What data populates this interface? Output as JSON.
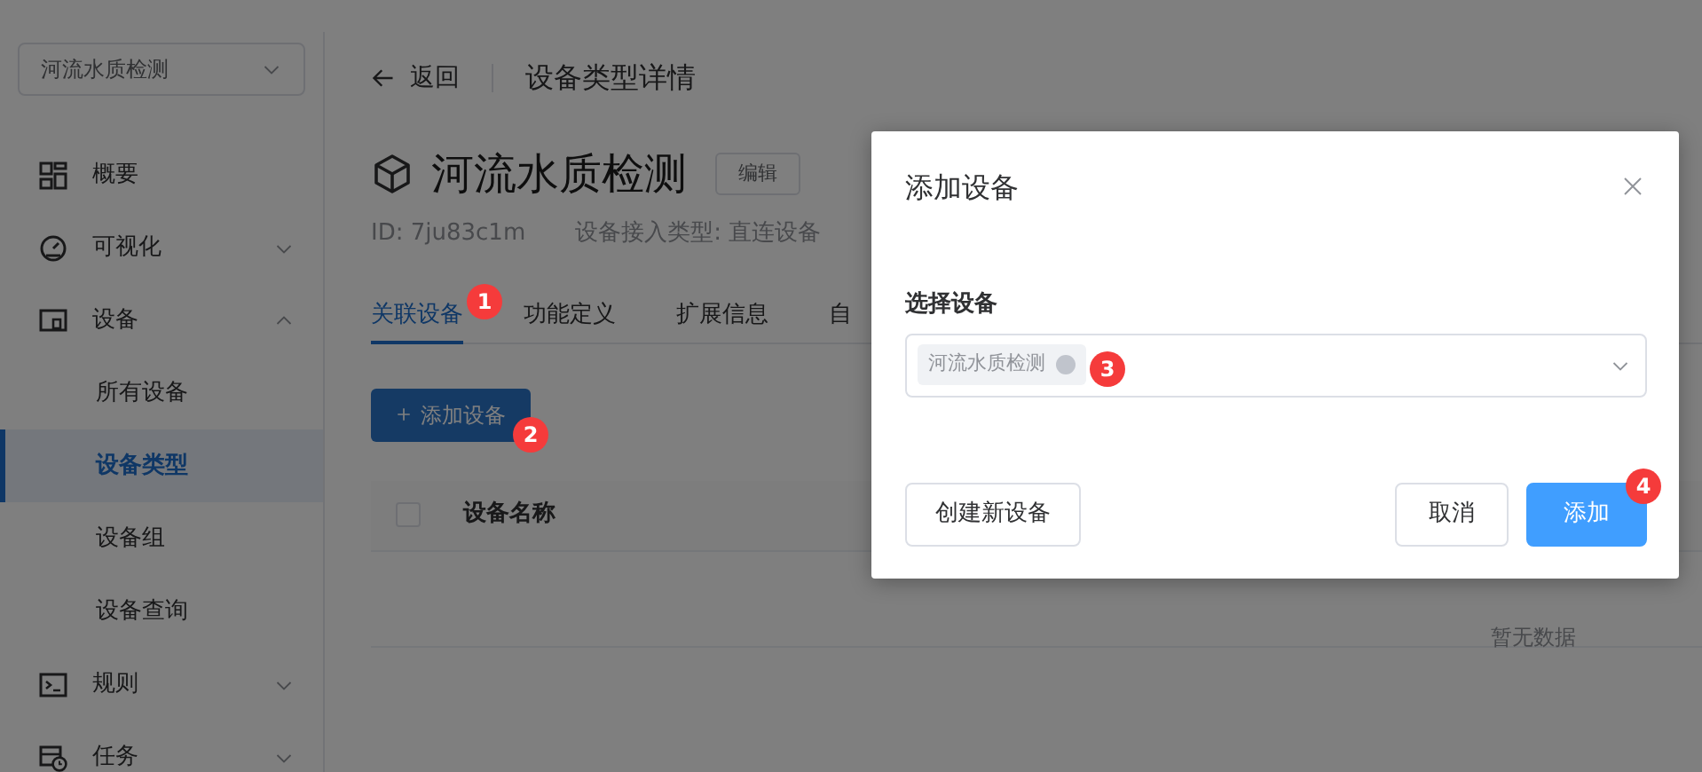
{
  "sidebar": {
    "project_select": {
      "value": "河流水质检测"
    },
    "items": [
      {
        "kind": "link",
        "label": "概要",
        "selected": false
      },
      {
        "kind": "group",
        "label": "可视化",
        "expanded": false,
        "selected": false
      },
      {
        "kind": "group",
        "label": "设备",
        "expanded": true,
        "selected": false,
        "children": [
          {
            "label": "所有设备",
            "selected": false
          },
          {
            "label": "设备类型",
            "selected": true
          },
          {
            "label": "设备组",
            "selected": false
          },
          {
            "label": "设备查询",
            "selected": false
          }
        ]
      },
      {
        "kind": "group",
        "label": "规则",
        "expanded": false,
        "selected": false
      },
      {
        "kind": "group",
        "label": "任务",
        "expanded": false,
        "selected": false
      }
    ]
  },
  "header": {
    "back": "返回",
    "title": "设备类型详情"
  },
  "device_type": {
    "name": "河流水质检测",
    "edit_button": "编辑",
    "id": "ID: 7ju83c1m",
    "access_type": "设备接入类型: 直连设备"
  },
  "tabs": [
    {
      "label": "关联设备",
      "selected": true,
      "marker": "1"
    },
    {
      "label": "功能定义",
      "selected": false
    },
    {
      "label": "扩展信息",
      "selected": false
    },
    {
      "label": "自",
      "selected": false
    }
  ],
  "add_button": {
    "label": "添加设备",
    "marker": "2"
  },
  "table": {
    "select_all": {
      "checked": false
    },
    "columns": [
      "设备名称"
    ],
    "empty_text": "暂无数据"
  },
  "dialog": {
    "title": "添加设备",
    "field_label": "选择设备",
    "selected_tags": [
      {
        "label": "河流水质检测",
        "marker": "3"
      }
    ],
    "buttons": [
      {
        "kind": "secondary",
        "label": "创建新设备"
      },
      {
        "kind": "secondary",
        "label": "取消"
      },
      {
        "kind": "primary",
        "label": "添加",
        "marker": "4"
      }
    ]
  }
}
